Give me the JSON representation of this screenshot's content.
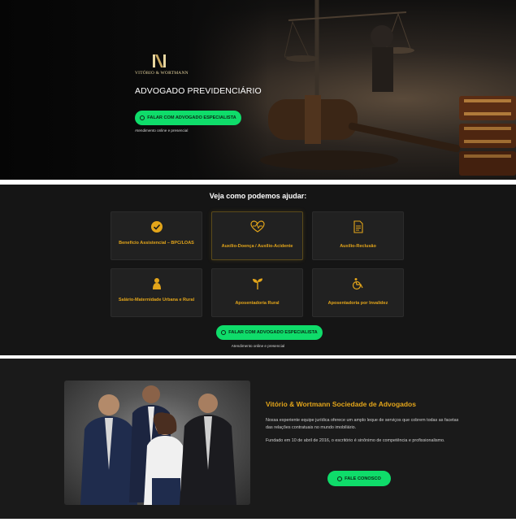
{
  "hero": {
    "logo_text": "VITÓRIO & WORTMANN",
    "title": "ADVOGADO PREVIDENCIÁRIO",
    "cta_label": "FALAR COM ADVOGADO ESPECIALISTA",
    "subtext": "Atendimento online e presencial"
  },
  "services": {
    "heading": "Veja como podemos ajudar:",
    "cards": [
      {
        "label": "Benefício Assistencial – BPC/LOAS",
        "icon": "check-circle-icon"
      },
      {
        "label": "Auxílio-Doença / Auxílio-Acidente",
        "icon": "heart-pulse-icon"
      },
      {
        "label": "Auxílio-Reclusão",
        "icon": "document-icon"
      },
      {
        "label": "Salário-Maternidade Urbana e Rural",
        "icon": "baby-icon"
      },
      {
        "label": "Aposentadoria Rural",
        "icon": "sprout-icon"
      },
      {
        "label": "Aposentadoria por Invalidez",
        "icon": "wheelchair-icon"
      }
    ],
    "cta_label": "FALAR COM ADVOGADO ESPECIALISTA",
    "subtext": "Atendimento online e presencial"
  },
  "about": {
    "title": "Vitório & Wortmann Sociedade de Advogados",
    "paragraph1": "Nossa experiente equipe jurídica oferece um amplo leque de serviços que cobrem todas as facetas das relações contratuais no mundo imobiliário.",
    "paragraph2": "Fundado em 10 de abril de 2016, o escritório é sinônimo de competência e profissionalismo.",
    "cta_label": "FALE CONOSCO"
  },
  "colors": {
    "accent": "#e3a51a",
    "cta": "#0fdc6a",
    "dark": "#151515"
  }
}
